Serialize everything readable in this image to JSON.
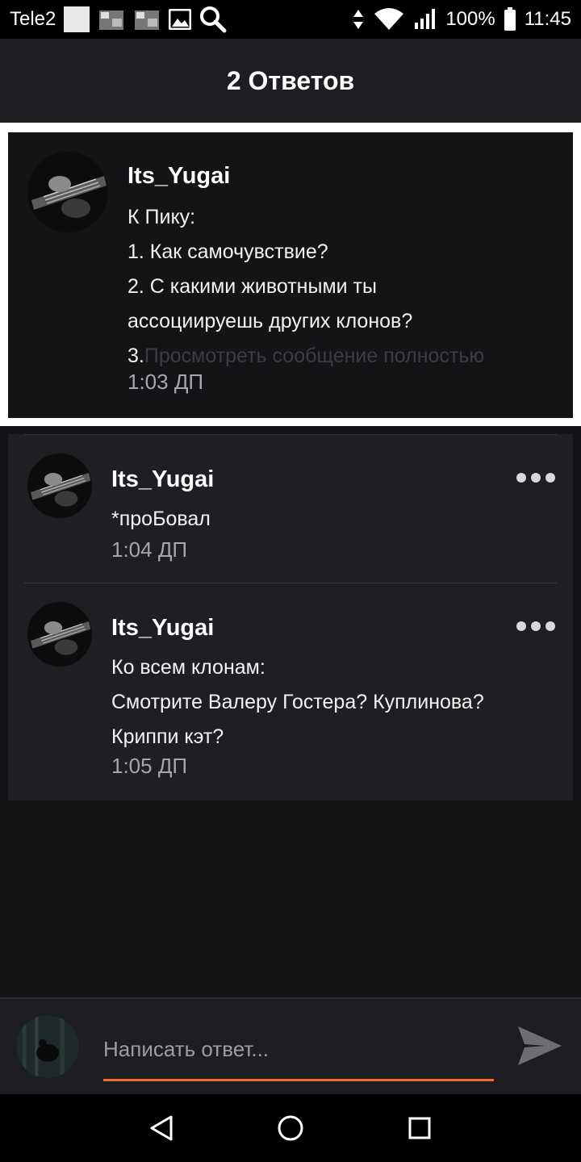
{
  "status_bar": {
    "carrier": "Tele2",
    "battery": "100%",
    "time": "11:45",
    "icons": [
      "white-square-icon",
      "video-thumb-icon",
      "video-thumb-icon",
      "image-icon",
      "search-icon",
      "data-arrows-icon",
      "wifi-icon",
      "signal-icon",
      "battery-icon"
    ]
  },
  "header": {
    "title": "2 Ответов"
  },
  "post": {
    "author": "Its_Yugai",
    "lines": [
      "К Пику:",
      "1. Как самочувствие?",
      "2. С какими животными ты",
      "ассоциируешь других клонов?"
    ],
    "last_line_prefix": "3.",
    "read_more": "Просмотреть сообщение полностью",
    "time": "1:03 ДП"
  },
  "replies": [
    {
      "author": "Its_Yugai",
      "lines": [
        "*проБовал"
      ],
      "time": "1:04 ДП"
    },
    {
      "author": "Its_Yugai",
      "lines": [
        "Ко всем клонам:",
        "Смотрите Валеру Гостера? Куплинова?",
        "Криппи кэт?"
      ],
      "time": "1:05 ДП"
    }
  ],
  "composer": {
    "placeholder": "Написать ответ..."
  },
  "colors": {
    "accent": "#f26a2e",
    "background": "#141316",
    "card": "#1f1e22",
    "muted_text": "#a7a6ad"
  }
}
